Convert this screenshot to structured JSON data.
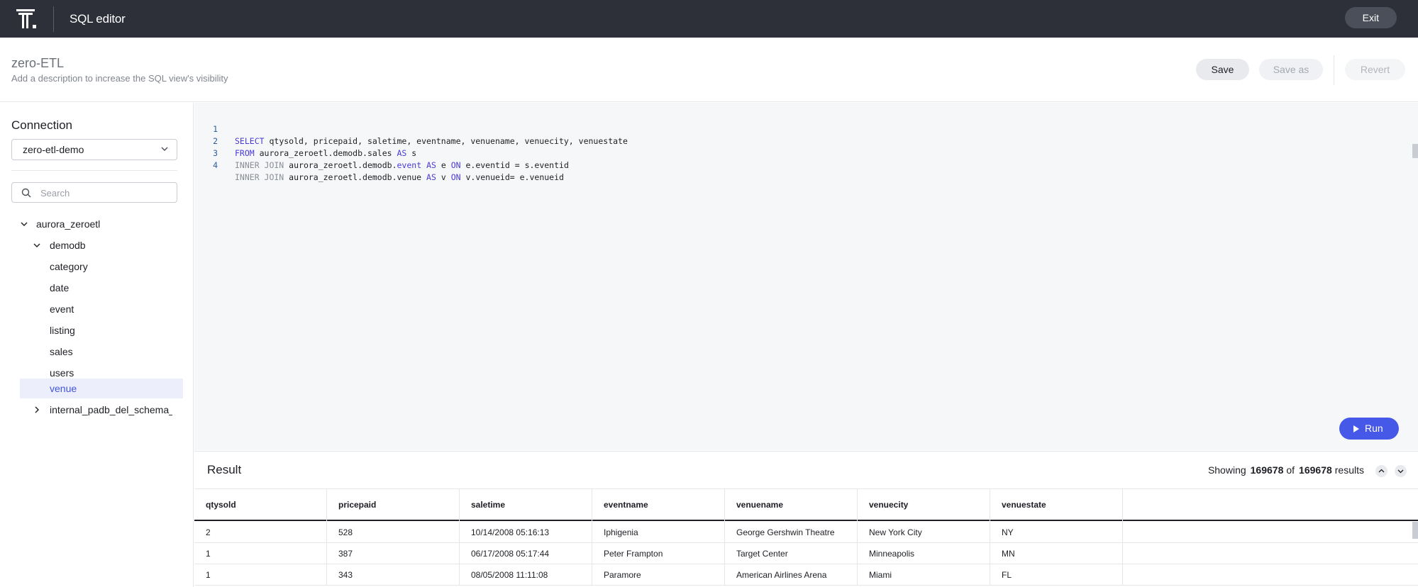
{
  "topbar": {
    "app_title": "SQL editor",
    "exit_label": "Exit"
  },
  "header": {
    "title": "zero-ETL",
    "description": "Add a description to increase the SQL view's visibility",
    "save_label": "Save",
    "save_as_label": "Save as",
    "revert_label": "Revert"
  },
  "sidebar": {
    "connection_label": "Connection",
    "connection_value": "zero-etl-demo",
    "search_placeholder": "Search",
    "tree": [
      {
        "label": "aurora_zeroetl",
        "expanded": true
      },
      {
        "label": "demodb",
        "expanded": true
      },
      {
        "label": "category"
      },
      {
        "label": "date"
      },
      {
        "label": "event"
      },
      {
        "label": "listing"
      },
      {
        "label": "sales"
      },
      {
        "label": "users"
      },
      {
        "label": "venue",
        "selected": true
      },
      {
        "label": "internal_padb_del_schema_",
        "expanded": false
      }
    ]
  },
  "editor": {
    "lines": [
      {
        "num": "1",
        "kw1": "SELECT",
        "rest1": " qtysold, pricepaid, saletime, eventname, venuename, venuecity, venuestate"
      },
      {
        "num": "2",
        "kw1": "FROM",
        "rest1": " aurora_zeroetl.demodb.sales ",
        "kw2": "AS",
        "rest2": " s"
      },
      {
        "num": "3",
        "kw1": "INNER JOIN",
        "rest1": " aurora_zeroetl.demodb.",
        "kw2": "event",
        "rest2": " ",
        "kw3": "AS",
        "rest3": " e ",
        "kw4": "ON",
        "rest4": " e.eventid = s.eventid"
      },
      {
        "num": "4",
        "kw1": "INNER JOIN",
        "rest1": " aurora_zeroetl.demodb.venue ",
        "kw2": "AS",
        "rest2": " v ",
        "kw3": "ON",
        "rest3": " v.venueid= e.venueid"
      }
    ],
    "run_label": "Run"
  },
  "result": {
    "title": "Result",
    "showing_label": "Showing",
    "shown_count": "169678",
    "of_label": "of",
    "total_count": "169678",
    "results_label": "results",
    "columns": [
      "qtysold",
      "pricepaid",
      "saletime",
      "eventname",
      "venuename",
      "venuecity",
      "venuestate"
    ],
    "rows": [
      [
        "2",
        "528",
        "10/14/2008 05:16:13",
        "Iphigenia",
        "George Gershwin Theatre",
        "New York City",
        "NY"
      ],
      [
        "1",
        "387",
        "06/17/2008 05:17:44",
        "Peter Frampton",
        "Target Center",
        "Minneapolis",
        "MN"
      ],
      [
        "1",
        "343",
        "08/05/2008 11:11:08",
        "Paramore",
        "American Airlines Arena",
        "Miami",
        "FL"
      ]
    ]
  }
}
